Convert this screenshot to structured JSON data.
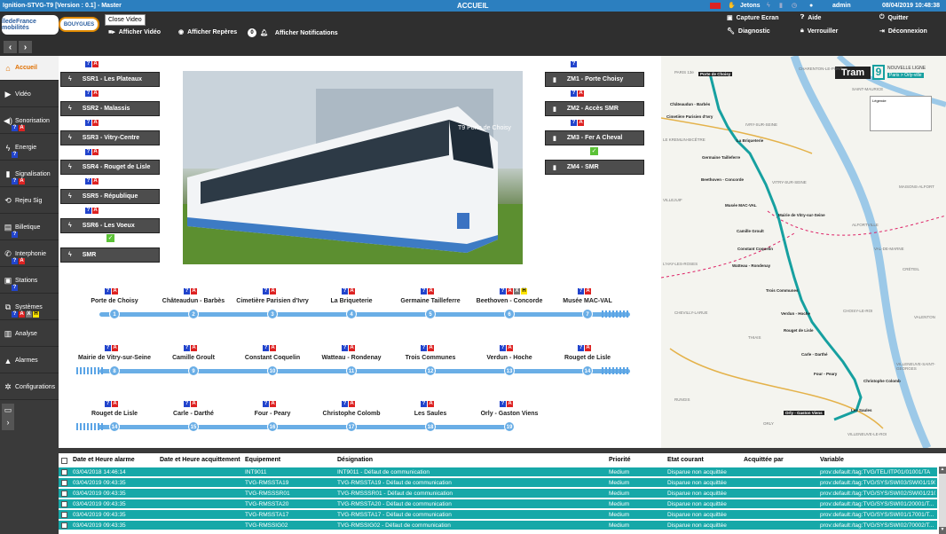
{
  "titlebar": {
    "app": "Ignition-STVG-T9 [Version : 0.1] - Master",
    "screen": "ACCUEIL",
    "jetons": "Jetons",
    "user": "admin",
    "datetime": "08/04/2019 10:48:38"
  },
  "topbar": {
    "logo1": "îledeFrance mobilités",
    "logo2": "BOUYGUES",
    "close_video": "Close Video",
    "afficher_video": "Afficher Vidéo",
    "afficher_reperes": "Afficher Repères",
    "notif_count": "0",
    "afficher_notifications": "Afficher Notifications",
    "capture": "Capture Ecran",
    "aide": "Aide",
    "quitter": "Quitter",
    "diagnostic": "Diagnostic",
    "verrouiller": "Verrouiller",
    "deconnexion": "Déconnexion"
  },
  "sidebar": {
    "items": [
      {
        "label": "Accueil",
        "icon": "home-icon"
      },
      {
        "label": "Vidéo",
        "icon": "video-icon"
      },
      {
        "label": "Sonorisation",
        "icon": "speaker-icon"
      },
      {
        "label": "Energie",
        "icon": "lightning-icon"
      },
      {
        "label": "Signalisation",
        "icon": "signal-icon"
      },
      {
        "label": "Rejeu Sig",
        "icon": "replay-icon"
      },
      {
        "label": "Billetique",
        "icon": "ticket-icon"
      },
      {
        "label": "Interphonie",
        "icon": "phone-icon"
      },
      {
        "label": "Stations",
        "icon": "station-icon"
      },
      {
        "label": "Systèmes",
        "icon": "network-icon"
      },
      {
        "label": "Analyse",
        "icon": "chart-icon"
      },
      {
        "label": "Alarmes",
        "icon": "bell-icon"
      },
      {
        "label": "Configurations",
        "icon": "gear-icon"
      }
    ],
    "badge_q": "?",
    "badge_a": "A",
    "badge_x": "X",
    "badge_h": "H"
  },
  "ssr": [
    "SSR1 - Les Plateaux",
    "SSR2 - Malassis",
    "SSR3 - Vitry-Centre",
    "SSR4 - Rouget de Lisle",
    "SSR5 - République",
    "SSR6 - Les Voeux",
    "SMR"
  ],
  "zm": [
    "ZM1 - Porte Choisy",
    "ZM2 - Accès SMR",
    "ZM3 - Fer A Cheval",
    "ZM4 - SMR"
  ],
  "line": {
    "stations": [
      {
        "n": "1",
        "name": "Porte de Choisy"
      },
      {
        "n": "2",
        "name": "Châteaudun - Barbès"
      },
      {
        "n": "3",
        "name": "Cimetière Parisien d'Ivry"
      },
      {
        "n": "4",
        "name": "La Briqueterie"
      },
      {
        "n": "5",
        "name": "Germaine Tailleferre"
      },
      {
        "n": "6",
        "name": "Beethoven - Concorde"
      },
      {
        "n": "7",
        "name": "Musée MAC-VAL"
      },
      {
        "n": "8",
        "name": "Mairie de Vitry-sur-Seine"
      },
      {
        "n": "9",
        "name": "Camille Groult"
      },
      {
        "n": "10",
        "name": "Constant Coquelin"
      },
      {
        "n": "11",
        "name": "Watteau - Rondenay"
      },
      {
        "n": "12",
        "name": "Trois Communes"
      },
      {
        "n": "13",
        "name": "Verdun - Hoche"
      },
      {
        "n": "14",
        "name": "Rouget de Lisle"
      },
      {
        "n": "14",
        "name": "Rouget de Lisle"
      },
      {
        "n": "15",
        "name": "Carle - Darthé"
      },
      {
        "n": "16",
        "name": "Four - Peary"
      },
      {
        "n": "17",
        "name": "Christophe Colomb"
      },
      {
        "n": "18",
        "name": "Les Saules"
      },
      {
        "n": "19",
        "name": "Orly - Gaston Viens"
      }
    ]
  },
  "photo": {
    "tram_sign": "T9 Porte de Choisy"
  },
  "map": {
    "logo": "Tram",
    "line": "9",
    "nouvelle": "NOUVELLE LIGNE",
    "route": "Paris > Orly-ville",
    "places": [
      "PARIS 13e",
      "CHARENTON-LE-PONT",
      "SAINT-MAURICE",
      "IVRY-SUR-SEINE",
      "LE KREMLIN-BICÊTRE",
      "VITRY-SUR-SEINE",
      "VILLEJUIF",
      "ALFORTVILLE",
      "MAISONS-ALFORT",
      "VAL-DE-MARNE",
      "L'HAY-LES-ROSES",
      "CRÉTEIL",
      "CHEVILLY-LARUE",
      "CHOISY-LE-ROI",
      "VALENTON",
      "THIAIS",
      "VILLENEUVE-SAINT-GEORGES",
      "RUNGIS",
      "ORLY",
      "VILLENEUVE-LE-ROI"
    ],
    "stops": [
      "Porte de Choisy",
      "Châteaudun - Barbès",
      "Cimetière Parisien d'Ivry",
      "La Briqueterie",
      "Germaine Tailleferre",
      "Beethoven - Concorde",
      "Musée MAC-VAL",
      "Mairie de Vitry-sur-Seine",
      "Camille Groult",
      "Constant Coquelin",
      "Watteau - Rondenay",
      "Trois Communes",
      "Verdun - Hoche",
      "Rouget de Lisle",
      "Carle - Darthé",
      "Four - Peary",
      "Christophe Colomb",
      "Les Saules",
      "Orly - Gaston Viens"
    ],
    "legend": "Légende"
  },
  "table": {
    "headers": [
      "Date et Heure alarme",
      "Date et Heure acquittement",
      "Equipement",
      "Désignation",
      "Priorité",
      "Etat courant",
      "Acquittée par",
      "Variable"
    ],
    "rows": [
      [
        "03/04/2018 14:46:14",
        "",
        "INT9011",
        "INT9011 - Défaut de communication",
        "Medium",
        "Disparue non acquittée",
        "",
        "prov:default:/tag:TVG/TEL/ITP01/01001/TA"
      ],
      [
        "03/04/2019 09:43:35",
        "",
        "TVG-RMSSTA19",
        "TVG-RMSSTA19 - Défaut de communication",
        "Medium",
        "Disparue non acquittée",
        "",
        "prov:default:/tag:TVG/SYS/SWI03/SWI01/19001/T..."
      ],
      [
        "03/04/2019 09:43:35",
        "",
        "TVG-RMSSSR01",
        "TVG-RMSSSR01 - Défaut de communication",
        "Medium",
        "Disparue non acquittée",
        "",
        "prov:default:/tag:TVG/SYS/SWI02/SWI01/21001/T..."
      ],
      [
        "03/04/2019 09:43:35",
        "",
        "TVG-RMSSTA20",
        "TVG-RMSSTA20 - Défaut de communication",
        "Medium",
        "Disparue non acquittée",
        "",
        "prov:default:/tag:TVG/SYS/SWI01/20001/T..."
      ],
      [
        "03/04/2019 09:43:35",
        "",
        "TVG-RMSSTA17",
        "TVG-RMSSTA17 - Défaut de communication",
        "Medium",
        "Disparue non acquittée",
        "",
        "prov:default:/tag:TVG/SYS/SWI01/17001/T..."
      ],
      [
        "03/04/2019 09:43:35",
        "",
        "TVG-RMSSIG02",
        "TVG-RMSSIG02 - Défaut de communication",
        "Medium",
        "Disparue non acquittée",
        "",
        "prov:default:/tag:TVG/SYS/SWI02/70002/T..."
      ]
    ]
  }
}
